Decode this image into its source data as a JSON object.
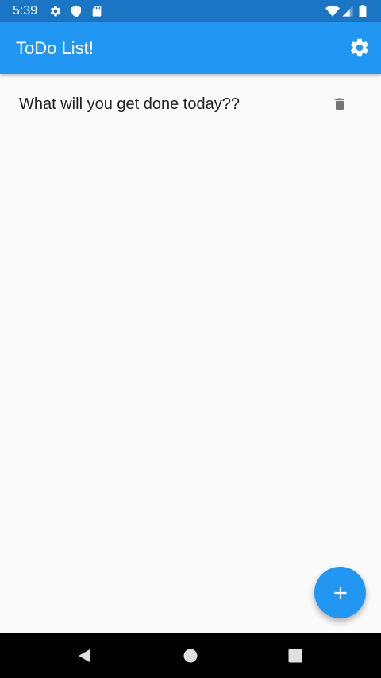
{
  "status_bar": {
    "time": "5:39",
    "background": "#1a75c4"
  },
  "app_bar": {
    "title": "ToDo List!",
    "background": "#2196f3",
    "settings_icon": "gear-icon"
  },
  "todos": [
    {
      "text": "What will you get done today??",
      "action_icon": "trash-icon"
    }
  ],
  "fab": {
    "icon": "plus-icon",
    "color": "#2196f3"
  },
  "nav_bar": {
    "buttons": [
      "back-icon",
      "home-icon",
      "recents-icon"
    ]
  }
}
